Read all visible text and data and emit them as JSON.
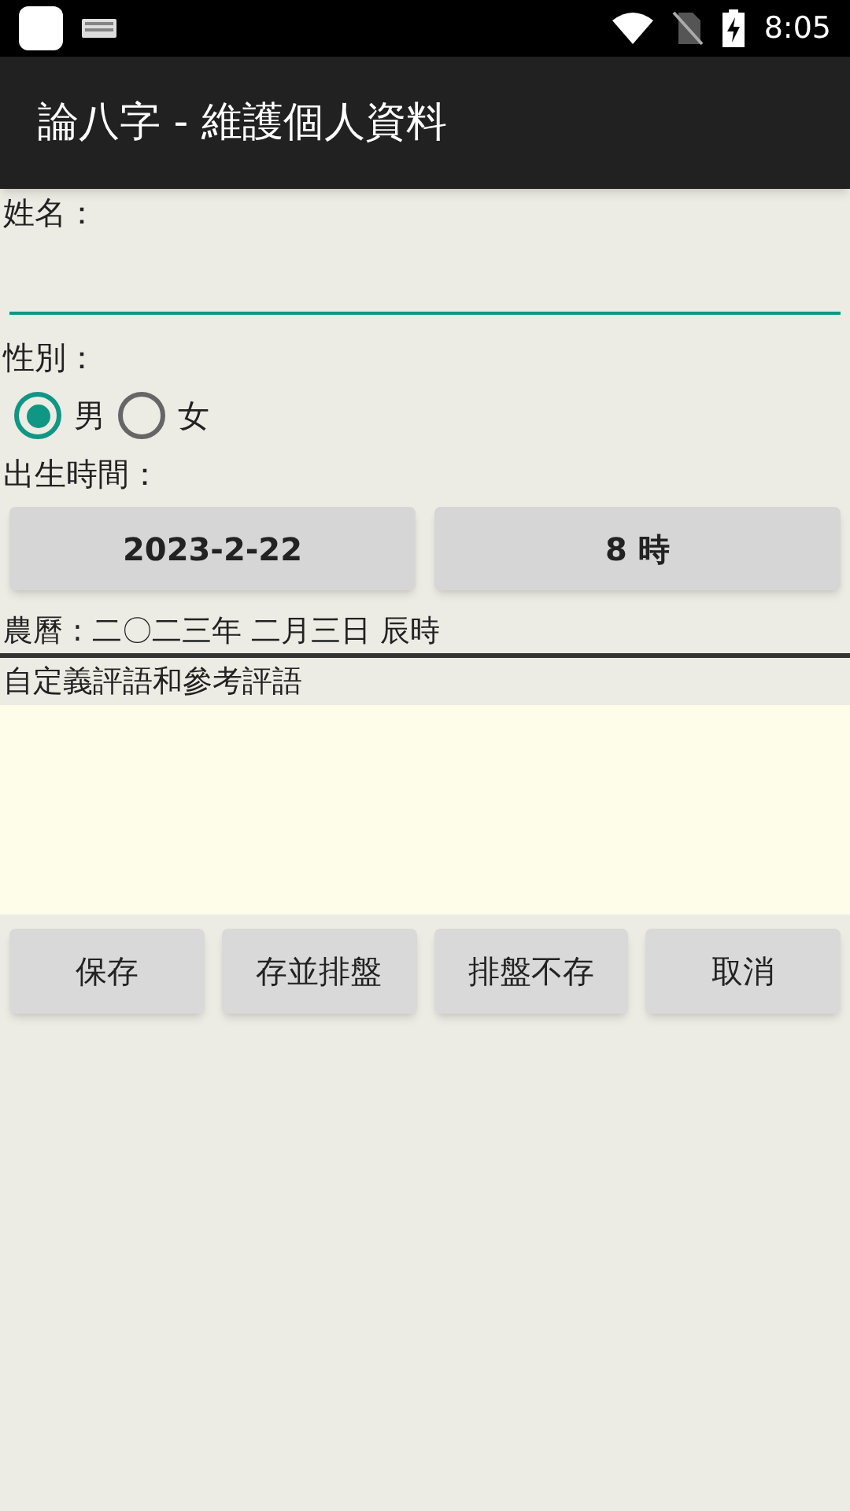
{
  "status_bar": {
    "time": "8:05"
  },
  "app_bar": {
    "title": "論八字 - 維護個人資料"
  },
  "name_field": {
    "label": "姓名："
  },
  "gender": {
    "label": "性別：",
    "options": [
      {
        "label": "男",
        "selected": true
      },
      {
        "label": "女",
        "selected": false
      }
    ]
  },
  "birth": {
    "label": "出生時間：",
    "date_button": "2023-2-22",
    "hour_button": "8 時",
    "lunar": "農曆 : 二〇二三年 二月三日 辰時"
  },
  "comments": {
    "label": "自定義評語和參考評語"
  },
  "buttons": [
    "保存",
    "存並排盤",
    "排盤不存",
    "取消"
  ]
}
